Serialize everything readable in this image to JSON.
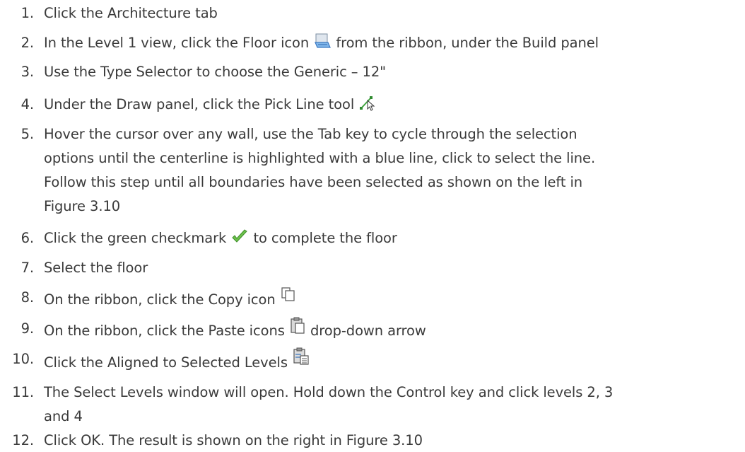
{
  "steps": [
    {
      "num": "1.",
      "lines": [
        "Click the Architecture tab"
      ]
    },
    {
      "num": "2.",
      "before": "In the Level 1 view, click the Floor icon",
      "after": "from the ribbon, under the Build panel",
      "icon": "floor-icon"
    },
    {
      "num": "3.",
      "lines": [
        "Use the Type Selector to choose the Generic – 12\""
      ]
    },
    {
      "num": "4.",
      "before": "Under the Draw panel, click the Pick Line tool",
      "after": "",
      "icon": "pick-line-icon"
    },
    {
      "num": "5.",
      "lines": [
        "Hover the cursor over any wall, use the Tab key to cycle through the selection",
        "options until the centerline is highlighted with a blue line, click to select the line.",
        "Follow this step until all boundaries have been selected as shown on the left in",
        "Figure 3.10"
      ]
    },
    {
      "num": "6.",
      "before": "Click the green checkmark",
      "after": "to complete the floor",
      "icon": "checkmark-icon"
    },
    {
      "num": "7.",
      "lines": [
        "Select the floor"
      ]
    },
    {
      "num": "8.",
      "before": "On the ribbon, click the Copy icon",
      "after": "",
      "icon": "copy-icon"
    },
    {
      "num": "9.",
      "before": "On the ribbon, click the Paste icons",
      "after": "drop-down arrow",
      "icon": "paste-icon"
    },
    {
      "num": "10.",
      "before": "Click the Aligned to Selected Levels",
      "after": "",
      "icon": "aligned-levels-icon"
    },
    {
      "num": "11.",
      "lines": [
        "The Select Levels window will open. Hold down the Control key and click levels 2, 3",
        "and 4"
      ]
    },
    {
      "num": "12.",
      "lines": [
        "Click OK. The result is shown on the right in Figure 3.10"
      ]
    }
  ]
}
